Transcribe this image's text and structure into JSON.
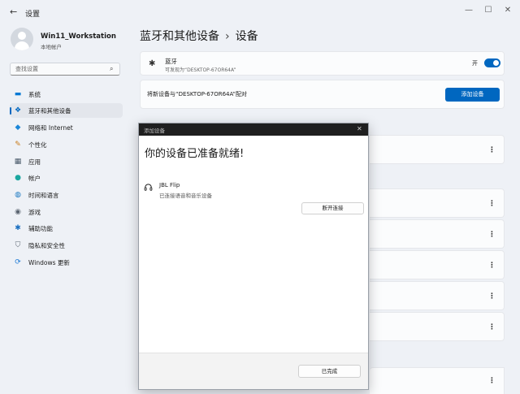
{
  "window": {
    "title": "设置",
    "back_icon": "←",
    "controls": {
      "minimize": "—",
      "maximize": "☐",
      "close": "✕"
    }
  },
  "user": {
    "name": "Win11_Workstation",
    "account": "本地帐户"
  },
  "search": {
    "placeholder": "查找设置",
    "icon": "⌕"
  },
  "sidebar": {
    "items": [
      {
        "label": "系统",
        "icon": "▬",
        "color": "#0078d4"
      },
      {
        "label": "蓝牙和其他设备",
        "icon": "❖",
        "color": "#0067c0",
        "active": true
      },
      {
        "label": "网络和 Internet",
        "icon": "◆",
        "color": "#1a86d8"
      },
      {
        "label": "个性化",
        "icon": "✎",
        "color": "#c87c1a"
      },
      {
        "label": "应用",
        "icon": "▦",
        "color": "#4a5a6a"
      },
      {
        "label": "帐户",
        "icon": "●",
        "color": "#1ba7a0"
      },
      {
        "label": "时间和语言",
        "icon": "◍",
        "color": "#1a78c2"
      },
      {
        "label": "游戏",
        "icon": "◉",
        "color": "#5a6470"
      },
      {
        "label": "辅助功能",
        "icon": "✱",
        "color": "#1a6fc0"
      },
      {
        "label": "隐私和安全性",
        "icon": "⛉",
        "color": "#5b6570"
      },
      {
        "label": "Windows 更新",
        "icon": "⟳",
        "color": "#1a78d4"
      }
    ]
  },
  "breadcrumb": {
    "parent": "蓝牙和其他设备",
    "separator": "›",
    "current": "设备"
  },
  "bluetooth": {
    "icon": "✱",
    "title": "蓝牙",
    "subtitle": "可发现为“DESKTOP-67OR64A”",
    "toggle_label": "开",
    "on": true
  },
  "pair": {
    "text": "将新设备与“DESKTOP-67OR64A”配对",
    "button": "添加设备"
  },
  "more_icon": "⋮",
  "dialog": {
    "title": "添加设备",
    "close_icon": "✕",
    "heading": "你的设备已准备就绪!",
    "device": {
      "icon": "🎧",
      "name": "JBL Flip",
      "status": "已连接语音和音乐设备"
    },
    "disconnect_button": "断开连接",
    "done_button": "已完成"
  },
  "colors": {
    "accent": "#0067c0",
    "background": "#eef1f6",
    "dialog_bar": "#1f1f1f"
  }
}
